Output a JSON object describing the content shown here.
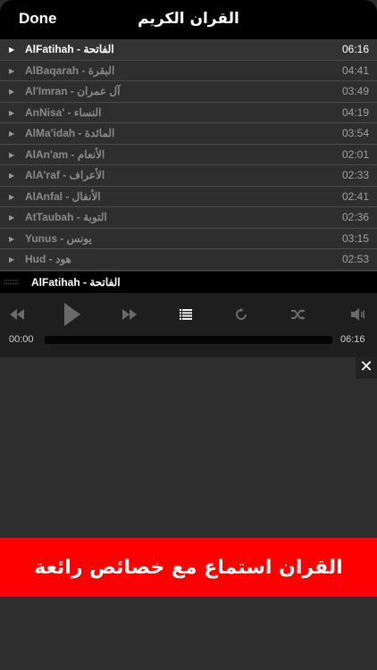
{
  "nav": {
    "done_label": "Done",
    "title": "القران الكريم"
  },
  "playlist": [
    {
      "name": "AlFatihah - الفاتحة",
      "duration": "06:16",
      "active": true
    },
    {
      "name": "AlBaqarah - البقرة",
      "duration": "04:41"
    },
    {
      "name": "Al'Imran - آل عمران",
      "duration": "03:49"
    },
    {
      "name": "AnNisa' - النساء",
      "duration": "04:19"
    },
    {
      "name": "AlMa'idah - المائدة",
      "duration": "03:54"
    },
    {
      "name": "AlAn'am - الأنعام",
      "duration": "02:01"
    },
    {
      "name": "AlA'raf - الأعراف",
      "duration": "02:33"
    },
    {
      "name": "AlAnfal - الأنفال",
      "duration": "02:41"
    },
    {
      "name": "AtTaubah - التوبة",
      "duration": "02:36"
    },
    {
      "name": "Yunus - يونس",
      "duration": "03:15"
    },
    {
      "name": "Hud - هود",
      "duration": "02:53"
    }
  ],
  "now_playing": {
    "name": "AlFatihah - الفاتحة"
  },
  "player": {
    "elapsed": "00:00",
    "total": "06:16",
    "progress": 0,
    "icons": [
      "rewind-icon",
      "play-icon",
      "fast-forward-icon",
      "playlist-icon",
      "repeat-icon",
      "shuffle-icon",
      "volume-icon"
    ]
  },
  "ad": {
    "close_glyph": "✕",
    "banner_text": "القران استماع مع خصائص رائعة"
  },
  "colors": {
    "banner": "#ff0000",
    "background": "#2b2b2b",
    "nav": "#000000"
  }
}
